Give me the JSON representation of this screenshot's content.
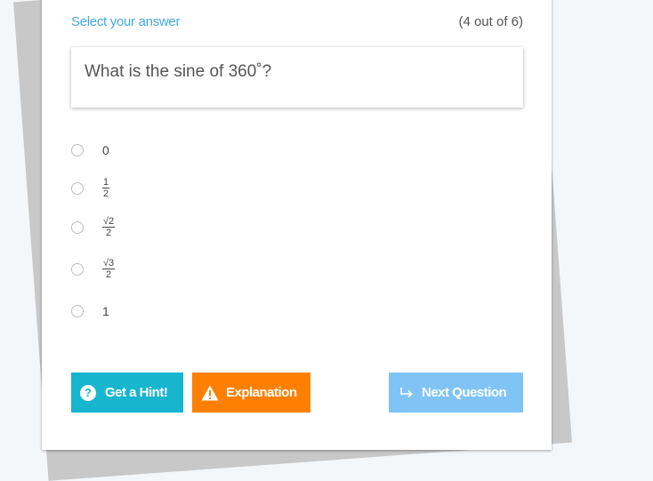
{
  "header": {
    "select_label": "Select your answer",
    "progress": "(4 out of 6)"
  },
  "question": {
    "text": "What is the sine of 360˚?"
  },
  "options": [
    {
      "label": "0"
    },
    {
      "num": "1",
      "den": "2"
    },
    {
      "num": "√2",
      "den": "2"
    },
    {
      "num": "√3",
      "den": "2"
    },
    {
      "label": "1"
    }
  ],
  "buttons": {
    "hint_label": "Get a Hint!",
    "explanation_label": "Explanation",
    "next_label": "Next Question"
  },
  "icons": {
    "hint": "question-circle-icon",
    "explanation": "warning-icon",
    "next": "arrow-return-icon"
  },
  "colors": {
    "accent": "#45a9e0",
    "hint": "#17b5ce",
    "explanation": "#ff8000",
    "next": "#80c4f6"
  }
}
